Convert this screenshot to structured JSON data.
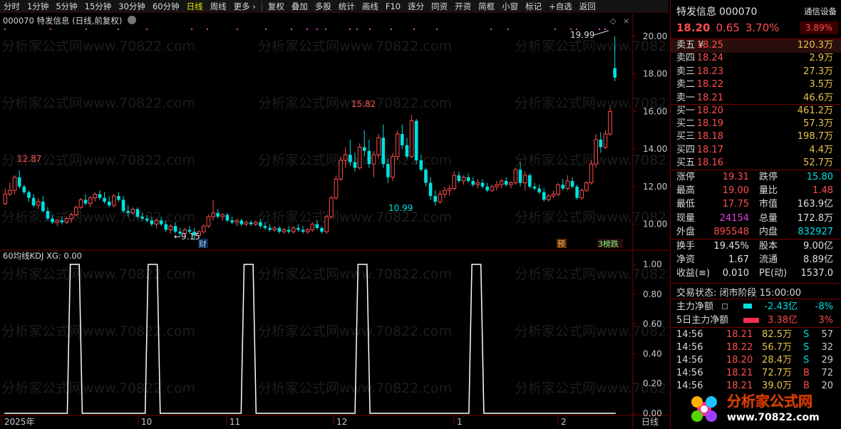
{
  "toolbar": {
    "items": [
      "分时",
      "1分钟",
      "5分钟",
      "15分钟",
      "30分钟",
      "60分钟",
      "日线",
      "周线",
      "更多 ›"
    ],
    "tools": [
      "复权",
      "叠加",
      "多股",
      "统计",
      "画线",
      "F10",
      "逐分",
      "同资",
      "开资",
      "简框",
      "小窗",
      "标记",
      "+自选",
      "返回"
    ]
  },
  "chart": {
    "info": "000070 特发信息 (日线,前复权)",
    "y_labels": [
      "20.00",
      "18.00",
      "16.00",
      "14.00",
      "12.00",
      "10.00"
    ],
    "annotations": {
      "high": "15.82",
      "low": "10.99",
      "left_high": "12.87",
      "left_low": "9.15",
      "peak": "19.99"
    },
    "markers": [
      "财",
      "预",
      "3榜跌"
    ],
    "watermark": "分析家公式网www.70822.com",
    "indicator_label": "60均线KDJ  XG: 0.00",
    "ind_y_labels": [
      "1.00",
      "0.80",
      "0.60",
      "0.40",
      "0.20",
      "0.00"
    ],
    "x_labels": [
      "2025年",
      "10",
      "11",
      "12",
      "1",
      "2",
      "日线"
    ]
  },
  "chart_data": [
    {
      "type": "candlestick",
      "title": "000070 特发信息 (日线,前复权)",
      "ylim": [
        9,
        20.6
      ],
      "candles": [
        [
          11.1,
          11.9,
          11.0,
          11.6
        ],
        [
          11.6,
          12.2,
          11.5,
          11.8
        ],
        [
          11.8,
          12.6,
          11.6,
          12.5
        ],
        [
          12.5,
          12.87,
          11.9,
          12.0
        ],
        [
          12.0,
          12.1,
          11.6,
          11.7
        ],
        [
          11.7,
          11.8,
          11.2,
          11.4
        ],
        [
          11.4,
          11.6,
          10.9,
          11.0
        ],
        [
          11.0,
          11.4,
          10.8,
          11.2
        ],
        [
          11.2,
          11.5,
          10.6,
          10.7
        ],
        [
          10.7,
          10.9,
          10.2,
          10.3
        ],
        [
          10.3,
          10.5,
          10.0,
          10.1
        ],
        [
          10.1,
          10.3,
          9.9,
          10.2
        ],
        [
          10.2,
          10.4,
          10.0,
          10.1
        ],
        [
          10.1,
          10.4,
          10.0,
          10.3
        ],
        [
          10.3,
          10.6,
          10.1,
          10.5
        ],
        [
          10.5,
          11.0,
          10.4,
          10.9
        ],
        [
          10.9,
          11.4,
          10.8,
          11.3
        ],
        [
          11.3,
          11.6,
          11.0,
          11.1
        ],
        [
          11.1,
          11.5,
          10.9,
          11.4
        ],
        [
          11.4,
          11.7,
          11.2,
          11.6
        ],
        [
          11.6,
          11.8,
          11.3,
          11.4
        ],
        [
          11.4,
          11.7,
          11.1,
          11.2
        ],
        [
          11.2,
          11.5,
          10.9,
          11.0
        ],
        [
          11.0,
          11.6,
          10.9,
          11.5
        ],
        [
          11.5,
          11.7,
          11.2,
          11.3
        ],
        [
          11.3,
          11.5,
          10.6,
          10.7
        ],
        [
          10.7,
          11.0,
          10.4,
          10.6
        ],
        [
          10.6,
          10.9,
          10.5,
          10.8
        ],
        [
          10.8,
          10.9,
          10.3,
          10.4
        ],
        [
          10.4,
          10.6,
          10.2,
          10.3
        ],
        [
          10.3,
          10.5,
          10.1,
          10.2
        ],
        [
          10.2,
          10.4,
          9.9,
          10.0
        ],
        [
          10.0,
          10.3,
          9.8,
          10.2
        ],
        [
          10.2,
          10.4,
          9.9,
          10.0
        ],
        [
          10.0,
          10.2,
          9.6,
          9.7
        ],
        [
          9.7,
          10.0,
          9.5,
          9.9
        ],
        [
          9.9,
          10.1,
          9.5,
          9.6
        ],
        [
          9.6,
          9.8,
          9.4,
          9.5
        ],
        [
          9.5,
          9.8,
          9.4,
          9.7
        ],
        [
          9.7,
          9.9,
          9.5,
          9.6
        ],
        [
          9.6,
          9.8,
          9.15,
          9.4
        ],
        [
          9.4,
          9.7,
          9.3,
          9.6
        ],
        [
          9.6,
          10.0,
          9.5,
          9.9
        ],
        [
          9.9,
          10.5,
          9.8,
          10.4
        ],
        [
          10.4,
          11.3,
          10.2,
          10.6
        ],
        [
          10.6,
          10.8,
          10.3,
          10.4
        ],
        [
          10.4,
          10.6,
          10.2,
          10.5
        ],
        [
          10.5,
          10.6,
          10.1,
          10.2
        ],
        [
          10.2,
          10.4,
          10.0,
          10.1
        ],
        [
          10.1,
          10.3,
          9.9,
          10.2
        ],
        [
          10.2,
          10.3,
          9.9,
          10.0
        ],
        [
          10.0,
          10.2,
          9.9,
          10.1
        ],
        [
          10.1,
          10.2,
          9.9,
          10.0
        ],
        [
          10.0,
          10.2,
          9.9,
          10.1
        ],
        [
          10.1,
          10.3,
          9.8,
          9.9
        ],
        [
          9.9,
          10.1,
          9.7,
          9.8
        ],
        [
          9.8,
          10.0,
          9.6,
          9.7
        ],
        [
          9.7,
          9.9,
          9.6,
          9.8
        ],
        [
          9.8,
          9.9,
          9.5,
          9.6
        ],
        [
          9.6,
          9.8,
          9.5,
          9.7
        ],
        [
          9.7,
          9.9,
          9.5,
          9.6
        ],
        [
          9.6,
          9.9,
          9.5,
          9.8
        ],
        [
          9.8,
          10.0,
          9.6,
          9.7
        ],
        [
          9.7,
          9.9,
          9.5,
          9.6
        ],
        [
          9.6,
          9.8,
          9.5,
          9.7
        ],
        [
          9.7,
          10.1,
          9.6,
          10.0
        ],
        [
          10.0,
          10.2,
          9.7,
          9.8
        ],
        [
          9.8,
          9.9,
          9.5,
          9.6
        ],
        [
          9.6,
          10.5,
          9.5,
          10.4
        ],
        [
          10.4,
          11.5,
          10.3,
          11.4
        ],
        [
          11.4,
          12.6,
          11.3,
          12.4
        ],
        [
          12.4,
          13.6,
          12.3,
          13.4
        ],
        [
          13.4,
          14.1,
          13.0,
          13.7
        ],
        [
          13.7,
          14.5,
          13.1,
          13.3
        ],
        [
          13.3,
          13.8,
          12.8,
          13.0
        ],
        [
          13.0,
          14.3,
          12.9,
          14.1
        ],
        [
          14.1,
          15.0,
          13.6,
          13.9
        ],
        [
          13.9,
          14.5,
          13.0,
          13.2
        ],
        [
          13.2,
          13.9,
          12.5,
          13.7
        ],
        [
          13.7,
          14.8,
          13.5,
          14.6
        ],
        [
          14.6,
          15.3,
          13.0,
          13.2
        ],
        [
          13.2,
          13.5,
          12.2,
          12.5
        ],
        [
          12.5,
          13.8,
          12.3,
          13.6
        ],
        [
          13.6,
          15.0,
          13.4,
          14.8
        ],
        [
          14.8,
          15.3,
          14.0,
          14.2
        ],
        [
          14.2,
          14.6,
          13.5,
          13.6
        ],
        [
          13.6,
          15.82,
          13.5,
          15.5
        ],
        [
          15.5,
          15.6,
          13.2,
          13.4
        ],
        [
          13.4,
          13.7,
          12.8,
          12.9
        ],
        [
          12.9,
          13.0,
          12.0,
          12.2
        ],
        [
          12.2,
          12.5,
          11.3,
          11.5
        ],
        [
          11.5,
          11.8,
          10.99,
          11.2
        ],
        [
          11.2,
          11.8,
          11.1,
          11.6
        ],
        [
          11.6,
          12.0,
          11.4,
          11.8
        ],
        [
          11.8,
          12.1,
          11.5,
          11.9
        ],
        [
          11.9,
          12.8,
          11.8,
          12.6
        ],
        [
          12.6,
          12.8,
          12.2,
          12.3
        ],
        [
          12.3,
          12.6,
          12.1,
          12.5
        ],
        [
          12.5,
          12.7,
          12.2,
          12.3
        ],
        [
          12.3,
          12.5,
          12.0,
          12.1
        ],
        [
          12.1,
          12.4,
          11.9,
          12.2
        ],
        [
          12.2,
          12.4,
          11.9,
          12.0
        ],
        [
          12.0,
          12.2,
          11.7,
          11.8
        ],
        [
          11.8,
          12.1,
          11.7,
          12.0
        ],
        [
          12.0,
          12.3,
          11.8,
          12.1
        ],
        [
          12.1,
          12.4,
          11.9,
          12.3
        ],
        [
          12.3,
          12.5,
          12.0,
          12.1
        ],
        [
          12.1,
          12.3,
          11.9,
          12.2
        ],
        [
          12.2,
          13.0,
          12.1,
          12.9
        ],
        [
          12.9,
          13.3,
          12.0,
          12.2
        ],
        [
          12.2,
          12.8,
          11.8,
          12.6
        ],
        [
          12.6,
          12.7,
          11.9,
          12.0
        ],
        [
          12.0,
          12.2,
          11.8,
          11.9
        ],
        [
          11.9,
          12.1,
          11.6,
          11.7
        ],
        [
          11.7,
          11.9,
          11.2,
          11.3
        ],
        [
          11.3,
          11.6,
          11.2,
          11.5
        ],
        [
          11.5,
          11.8,
          11.4,
          11.6
        ],
        [
          11.6,
          12.2,
          11.5,
          12.1
        ],
        [
          12.1,
          12.4,
          11.8,
          11.9
        ],
        [
          11.9,
          12.6,
          11.8,
          12.3
        ],
        [
          12.3,
          12.5,
          11.9,
          12.0
        ],
        [
          12.0,
          12.1,
          11.3,
          11.4
        ],
        [
          11.4,
          11.9,
          11.3,
          11.8
        ],
        [
          11.8,
          12.3,
          11.7,
          12.2
        ],
        [
          12.2,
          13.4,
          12.1,
          13.2
        ],
        [
          13.2,
          14.8,
          13.0,
          14.5
        ],
        [
          14.5,
          14.9,
          13.8,
          14.1
        ],
        [
          14.1,
          15.0,
          14.0,
          14.8
        ],
        [
          14.8,
          16.2,
          14.7,
          16.0
        ],
        [
          18.3,
          19.99,
          17.6,
          17.8
        ]
      ]
    },
    {
      "type": "line",
      "title": "60均线KDJ",
      "series": [
        {
          "name": "XG",
          "values": [
            0,
            0,
            0,
            0,
            0,
            0,
            0,
            0,
            0,
            0,
            0,
            0,
            0,
            0,
            0,
            0,
            0,
            0,
            0,
            0,
            0,
            0,
            1,
            1,
            1,
            1,
            0,
            0,
            0,
            0,
            0,
            0,
            0,
            0,
            0,
            0,
            0,
            0,
            0,
            0,
            0,
            0,
            0,
            0,
            0,
            0,
            0,
            0,
            1,
            1,
            1,
            1,
            0,
            0,
            0,
            0,
            0,
            0,
            0,
            0,
            0,
            0,
            0,
            0,
            0,
            0,
            0,
            0,
            0,
            0,
            0,
            0,
            0,
            0,
            0,
            0,
            0,
            0,
            0,
            0,
            1,
            1,
            1,
            1,
            0,
            0,
            0,
            0,
            0,
            0,
            0,
            0,
            0,
            0,
            0,
            0,
            0,
            0,
            0,
            0,
            0,
            0,
            0,
            0,
            0,
            0,
            0,
            0,
            0,
            0,
            0,
            0,
            0,
            0,
            0,
            0,
            0,
            0,
            1,
            1,
            1,
            1,
            0,
            0,
            0,
            0,
            0,
            0,
            0,
            0,
            0,
            0,
            0,
            0,
            0,
            0,
            0,
            0,
            0,
            0,
            0,
            0,
            0,
            0,
            0,
            0,
            0,
            0,
            0,
            0,
            0,
            0,
            0,
            0,
            0,
            0,
            1,
            1,
            1,
            1,
            0,
            0,
            0,
            0,
            0,
            0,
            0,
            0,
            0,
            0,
            0,
            0,
            0,
            0,
            0,
            0,
            0,
            0,
            0,
            0,
            0,
            0,
            0,
            0,
            0,
            0,
            0,
            0,
            0,
            0,
            0,
            0,
            0,
            0,
            0,
            0,
            0,
            0,
            0,
            0,
            0,
            0,
            0,
            0,
            0
          ]
        }
      ],
      "ylim": [
        0,
        1
      ]
    }
  ],
  "panel": {
    "name": "特发信息",
    "code": "000070",
    "sector": "通信设备",
    "price": "18.20",
    "change": "0.65",
    "change_pct": "3.70%",
    "sector_pct": "3.89%",
    "sell": [
      {
        "label": "卖五 ¥",
        "price": "18.25",
        "vol": "120.3万"
      },
      {
        "label": "卖四",
        "price": "18.24",
        "vol": "2.9万"
      },
      {
        "label": "卖三",
        "price": "18.23",
        "vol": "27.3万"
      },
      {
        "label": "卖二",
        "price": "18.22",
        "vol": "3.5万"
      },
      {
        "label": "卖一",
        "price": "18.21",
        "vol": "46.6万"
      }
    ],
    "buy": [
      {
        "label": "买一",
        "price": "18.20",
        "vol": "461.2万"
      },
      {
        "label": "买二",
        "price": "18.19",
        "vol": "57.3万"
      },
      {
        "label": "买三",
        "price": "18.18",
        "vol": "198.7万"
      },
      {
        "label": "买四",
        "price": "18.17",
        "vol": "4.4万"
      },
      {
        "label": "买五",
        "price": "18.16",
        "vol": "52.7万"
      }
    ],
    "stats": [
      {
        "k1": "涨停",
        "v1": "19.31",
        "c1": "red",
        "k2": "跌停",
        "v2": "15.80",
        "c2": "green"
      },
      {
        "k1": "最高",
        "v1": "19.00",
        "c1": "red",
        "k2": "量比",
        "v2": "1.48",
        "c2": "red"
      },
      {
        "k1": "最低",
        "v1": "17.75",
        "c1": "red",
        "k2": "市值",
        "v2": "163.9亿",
        "c2": "white"
      },
      {
        "k1": "现量",
        "v1": "24154",
        "c1": "magenta",
        "k2": "总量",
        "v2": "172.8万",
        "c2": "white"
      },
      {
        "k1": "外盘",
        "v1": "895548",
        "c1": "red",
        "k2": "内盘",
        "v2": "832927",
        "c2": "green"
      }
    ],
    "stats2": [
      {
        "k1": "换手",
        "v1": "19.45%",
        "c1": "white",
        "k2": "股本",
        "v2": "9.00亿",
        "c2": "white"
      },
      {
        "k1": "净资",
        "v1": "1.67",
        "c1": "white",
        "k2": "流通",
        "v2": "8.89亿",
        "c2": "white"
      },
      {
        "k1": "收益(≡)",
        "v1": "0.010",
        "c1": "white",
        "k2": "PE(动)",
        "v2": "1537.0",
        "c2": "white"
      }
    ],
    "trade_status": "交易状态: 闭市阶段 15:00:00",
    "main_net": {
      "label": "主力净额",
      "value": "-2.43亿",
      "pct": "-8%"
    },
    "main_net5": {
      "label": "5日主力净额",
      "value": "3.38亿",
      "pct": "3%"
    },
    "ticks": [
      {
        "t": "14:56",
        "p": "18.21",
        "v": "82.5万",
        "bs": "S",
        "n": "57"
      },
      {
        "t": "14:56",
        "p": "18.22",
        "v": "56.7万",
        "bs": "S",
        "n": "32"
      },
      {
        "t": "14:56",
        "p": "18.20",
        "v": "28.4万",
        "bs": "S",
        "n": "29"
      },
      {
        "t": "14:56",
        "p": "18.21",
        "v": "72.7万",
        "bs": "B",
        "n": "72"
      },
      {
        "t": "14:56",
        "p": "18.21",
        "v": "39.0万",
        "bs": "B",
        "n": "20"
      }
    ],
    "logo_text": "分析家公式网",
    "logo_url": "www.70822.com"
  },
  "colors": {
    "up": "#ff4d4d",
    "down": "#00e0e0",
    "accent": "#e8c34a",
    "line": "#ffffff",
    "signal": "#e040e0"
  }
}
